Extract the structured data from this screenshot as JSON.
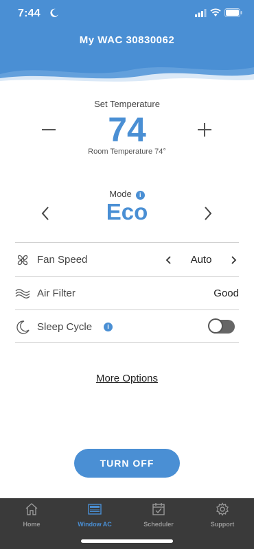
{
  "status_bar": {
    "time": "7:44"
  },
  "header": {
    "title": "My WAC 30830062"
  },
  "temperature": {
    "label": "Set Temperature",
    "value": "74",
    "room": "Room Temperature 74°"
  },
  "mode": {
    "label": "Mode",
    "info": "i",
    "value": "Eco"
  },
  "rows": {
    "fan_speed": {
      "label": "Fan Speed",
      "value": "Auto"
    },
    "air_filter": {
      "label": "Air Filter",
      "value": "Good"
    },
    "sleep_cycle": {
      "label": "Sleep Cycle",
      "info": "i",
      "enabled": false
    }
  },
  "more_options": "More Options",
  "turn_off": "TURN OFF",
  "tabs": [
    {
      "label": "Home",
      "icon": "home-icon"
    },
    {
      "label": "Window AC",
      "icon": "window-ac-icon"
    },
    {
      "label": "Scheduler",
      "icon": "calendar-check-icon"
    },
    {
      "label": "Support",
      "icon": "gear-icon"
    }
  ],
  "colors": {
    "accent": "#4a8fd4",
    "tabbar": "#3a3a3a"
  }
}
